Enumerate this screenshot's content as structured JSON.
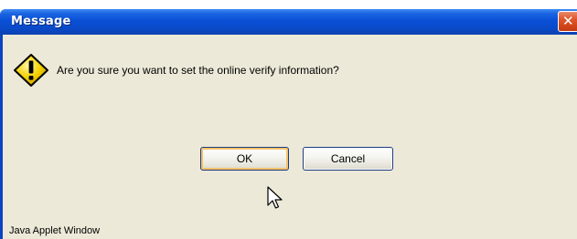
{
  "window": {
    "title": "Message",
    "close_icon": "close-icon"
  },
  "dialog": {
    "icon": "warning-icon",
    "message": "Are you sure you want to set the online verify information?"
  },
  "buttons": {
    "ok_label": "OK",
    "cancel_label": "Cancel"
  },
  "status": {
    "applet_label": "Java Applet Window"
  },
  "colors": {
    "title_bar": "#0a4fd6",
    "dialog_background": "#ece9d8",
    "close_button": "#d3461b",
    "warning_icon": "#f5d000",
    "default_button_focus": "#f6c26a"
  }
}
